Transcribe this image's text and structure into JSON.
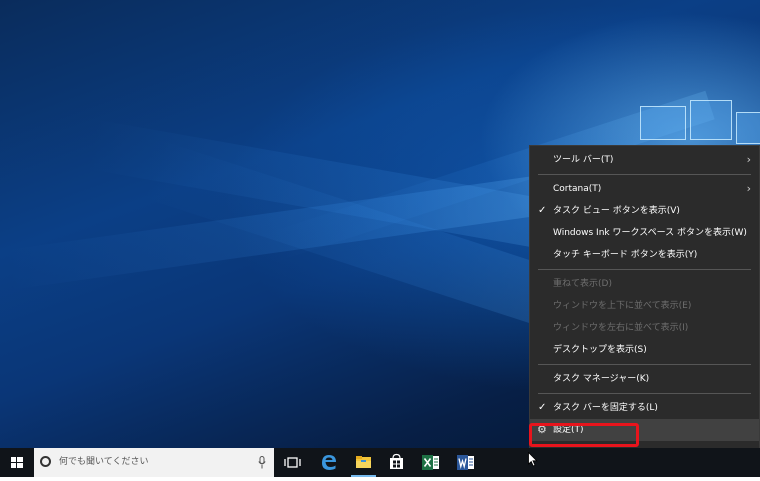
{
  "context_menu": {
    "items": [
      {
        "label": "ツール バー(T)",
        "checked": false,
        "submenu": true,
        "disabled": false
      },
      {
        "label": "Cortana(T)",
        "checked": false,
        "submenu": true,
        "disabled": false
      },
      {
        "label": "タスク ビュー ボタンを表示(V)",
        "checked": true,
        "submenu": false,
        "disabled": false
      },
      {
        "label": "Windows Ink ワークスペース ボタンを表示(W)",
        "checked": false,
        "submenu": false,
        "disabled": false
      },
      {
        "label": "タッチ キーボード ボタンを表示(Y)",
        "checked": false,
        "submenu": false,
        "disabled": false
      },
      {
        "label": "重ねて表示(D)",
        "checked": false,
        "submenu": false,
        "disabled": true
      },
      {
        "label": "ウィンドウを上下に並べて表示(E)",
        "checked": false,
        "submenu": false,
        "disabled": true
      },
      {
        "label": "ウィンドウを左右に並べて表示(I)",
        "checked": false,
        "submenu": false,
        "disabled": true
      },
      {
        "label": "デスクトップを表示(S)",
        "checked": false,
        "submenu": false,
        "disabled": false
      },
      {
        "label": "タスク マネージャー(K)",
        "checked": false,
        "submenu": false,
        "disabled": false
      },
      {
        "label": "タスク バーを固定する(L)",
        "checked": true,
        "submenu": false,
        "disabled": false
      },
      {
        "label": "設定(T)",
        "checked": false,
        "submenu": false,
        "disabled": false,
        "icon": "gear-icon",
        "highlighted": true
      }
    ]
  },
  "taskbar": {
    "search_placeholder": "何でも聞いてください",
    "icons": [
      "windows-logo-icon",
      "cortana-icon",
      "microphone-icon",
      "task-view-icon",
      "edge-icon",
      "file-explorer-icon",
      "store-icon",
      "excel-icon",
      "word-icon"
    ]
  },
  "colors": {
    "menu_bg": "#2b2b2b",
    "highlight_border": "#e8141c",
    "taskbar_bg": "#101419",
    "accent": "#76b9ed"
  }
}
